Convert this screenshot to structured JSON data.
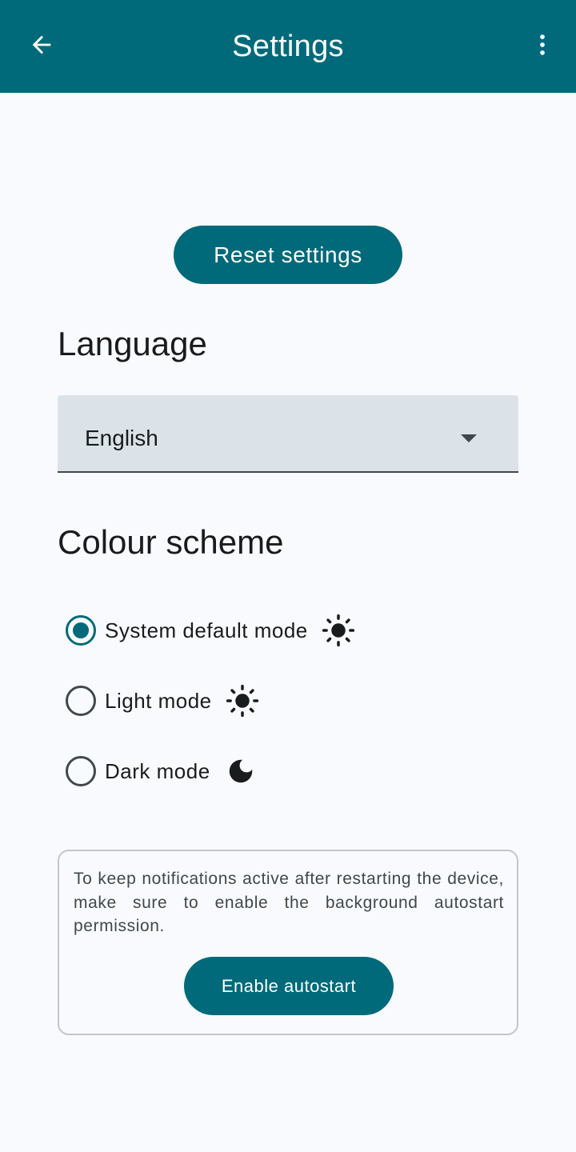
{
  "app_bar": {
    "title": "Settings",
    "back_icon": "arrow-back-icon",
    "more_icon": "more-vert-icon"
  },
  "reset_button": "Reset settings",
  "language": {
    "title": "Language",
    "selected": "English"
  },
  "colour_scheme": {
    "title": "Colour scheme",
    "options": [
      {
        "label": "System default mode",
        "icon": "sun-icon",
        "selected": true
      },
      {
        "label": "Light mode",
        "icon": "sun-icon",
        "selected": false
      },
      {
        "label": "Dark mode",
        "icon": "moon-icon",
        "selected": false
      }
    ]
  },
  "autostart": {
    "message": "To keep notifications active after restarting the device, make sure to enable the background autostart permission.",
    "button": "Enable autostart"
  },
  "colors": {
    "primary": "#006a7a",
    "background": "#f8fafd",
    "dropdown_fill": "#dce3e8"
  }
}
